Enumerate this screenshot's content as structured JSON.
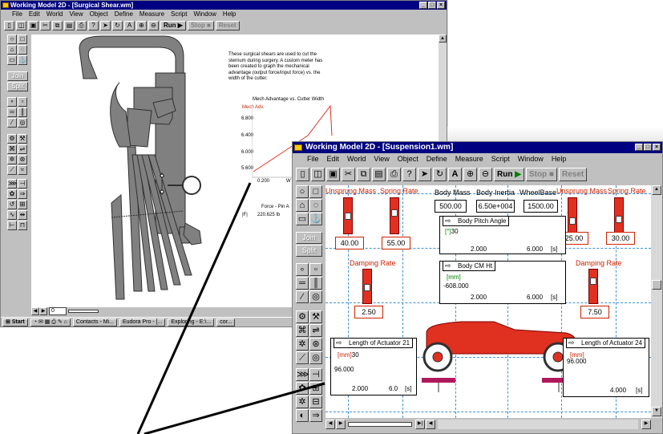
{
  "back_window": {
    "title": "Working Model 2D - [Surgical Shear.wm]",
    "menu": [
      "File",
      "Edit",
      "World",
      "View",
      "Object",
      "Define",
      "Measure",
      "Script",
      "Window",
      "Help"
    ],
    "run_label": "Run",
    "stop_label": "Stop",
    "reset_label": "Reset",
    "join_label": "Join",
    "split_label": "Split",
    "description": "These surgical shears are used to cut the sternum during surgery. A custom meter has been created to graph the mechanical advantage (output force/input force) vs. the width of the cutter.",
    "graph": {
      "title": "Mech Advantage vs. Cutter Width",
      "ylabel": "Mech Adv.",
      "y_ticks": [
        "6.800",
        "6.400",
        "6.000",
        "5.600"
      ],
      "x_ticks": [
        "0.200",
        "W"
      ]
    },
    "force_title": "Force - Pin A",
    "force_label": "|F|",
    "force_value": "220.625 lb",
    "scroll_value": "0"
  },
  "taskbar": {
    "start": "Start",
    "items": [
      "Contacts - Mi...",
      "Eudora Pro - [...",
      "Exploring - E:\\...",
      "cor..."
    ]
  },
  "front_window": {
    "title": "Working Model 2D - [Suspension1.wm]",
    "menu": [
      "File",
      "Edit",
      "World",
      "View",
      "Object",
      "Define",
      "Measure",
      "Script",
      "Window",
      "Help"
    ],
    "run_label": "Run",
    "stop_label": "Stop",
    "reset_label": "Reset",
    "join_label": "Join",
    "split_label": "Split",
    "labels": {
      "unsprung_mass_left": "Unsprung Mass",
      "spring_rate_left": "Spring Rate",
      "body_mass": "Body Mass",
      "body_inertia": "Body Inertia",
      "wheelbase": "WheelBase",
      "unsprung_mass_right": "Unsprung Mass",
      "spring_rate_right": "Spring Rate",
      "damping_rate_left": "Damping Rate",
      "damping_rate_right": "Damping Rate"
    },
    "values": {
      "unsprung_mass_left": "40.00",
      "spring_rate_left": "55.00",
      "body_mass": "500.00",
      "body_inertia": "6.50e+004",
      "wheelbase": "1500.00",
      "unsprung_mass_right": "25.00",
      "spring_rate_right": "30.00",
      "damping_rate_left": "2.50",
      "damping_rate_right": "7.50"
    },
    "meters": {
      "pitch": {
        "title": "Body Pitch Angle",
        "unit": "[°]",
        "top": "30",
        "x_start": "2.000",
        "x_end": "6.000",
        "x_unit": "[s]"
      },
      "cm": {
        "title": "Body CM Ht",
        "unit": "[mm]",
        "value": "-608.000",
        "x_start": "2.000",
        "x_end": "6.000",
        "x_unit": "[s]"
      },
      "act21": {
        "title": "Length of Actuator 21",
        "unit": "[mm]",
        "top": "30",
        "value": "96.000",
        "x_start": "2.000",
        "x_end": "6.0",
        "x_unit": "[s]"
      },
      "act24": {
        "title": "Length of Actuator 24",
        "unit": "[mm]",
        "top": "96.000",
        "x_end": "4.000",
        "x_unit": "[s]"
      }
    }
  }
}
